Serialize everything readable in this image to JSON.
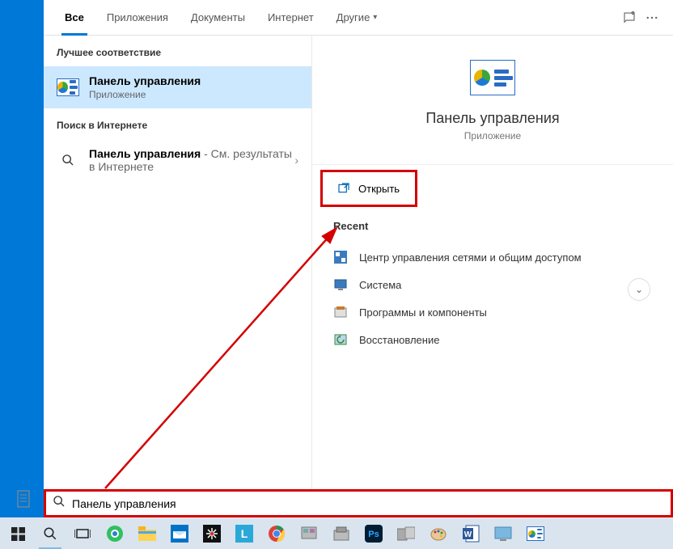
{
  "tabs": {
    "all": "Все",
    "apps": "Приложения",
    "docs": "Документы",
    "web": "Интернет",
    "other": "Другие"
  },
  "sections": {
    "best_match": "Лучшее соответствие",
    "web_search": "Поиск в Интернете"
  },
  "best_match": {
    "title": "Панель управления",
    "subtitle": "Приложение"
  },
  "web_result": {
    "title": "Панель управления",
    "suffix": " - См. результаты в Интернете"
  },
  "preview": {
    "title": "Панель управления",
    "subtitle": "Приложение",
    "open_label": "Открыть"
  },
  "recent": {
    "header": "Recent",
    "items": [
      "Центр управления сетями и общим доступом",
      "Система",
      "Программы и компоненты",
      "Восстановление"
    ]
  },
  "search": {
    "value": "Панель управления"
  },
  "colors": {
    "accent": "#0078d4",
    "highlight_border": "#d40000"
  }
}
